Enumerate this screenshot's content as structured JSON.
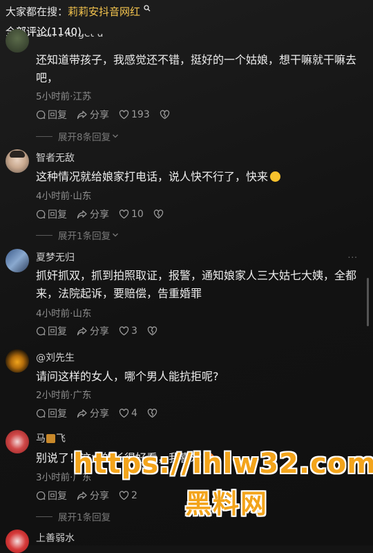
{
  "header": {
    "hot_search_prefix": "大家都在搜：",
    "hot_search_keyword": "莉莉安抖音网红",
    "search_icon": "search-icon",
    "comment_count": "全部评论(1140)"
  },
  "comments": [
    {
      "username": "Don't forget u",
      "text": "还知道带孩子，我感觉还不错，挺好的一个姑娘，想干嘛就干嘛去吧，",
      "time": "5小时前",
      "location": "江苏",
      "reply_label": "回复",
      "share_label": "分享",
      "likes": "193",
      "expand": "展开8条回复"
    },
    {
      "username": "智者无敌",
      "text": "这种情况就给娘家打电话，说人快不行了，快来",
      "time": "4小时前",
      "location": "山东",
      "reply_label": "回复",
      "share_label": "分享",
      "likes": "10",
      "expand": "展开1条回复"
    },
    {
      "username": "夏梦无归",
      "text": "抓奸抓双，抓到拍照取证，报警，通知娘家人三大姑七大姨，全都来，法院起诉，要赔偿，告重婚罪",
      "time": "4小时前",
      "location": "山东",
      "reply_label": "回复",
      "share_label": "分享",
      "likes": "3",
      "more": "..."
    },
    {
      "username": "@刘先生",
      "text": "请问这样的女人，哪个男人能抗拒呢?",
      "time": "2小时前",
      "location": "广东",
      "reply_label": "回复",
      "share_label": "分享",
      "likes": "4"
    },
    {
      "username_a": "马",
      "username_b": "飞",
      "text": "别说了！这女的长得好看，我喜欢",
      "time": "3小时前",
      "location": "广东",
      "reply_label": "回复",
      "share_label": "分享",
      "likes": "2",
      "expand": "展开1条回复"
    },
    {
      "username": "上善弱水"
    }
  ],
  "meta_separator": "·",
  "watermark": {
    "url": "https://ihlw32.com",
    "name": "黑料网"
  },
  "colors": {
    "background": "#141414",
    "keyword": "#f4c44e",
    "watermark": "#f3a41b"
  }
}
